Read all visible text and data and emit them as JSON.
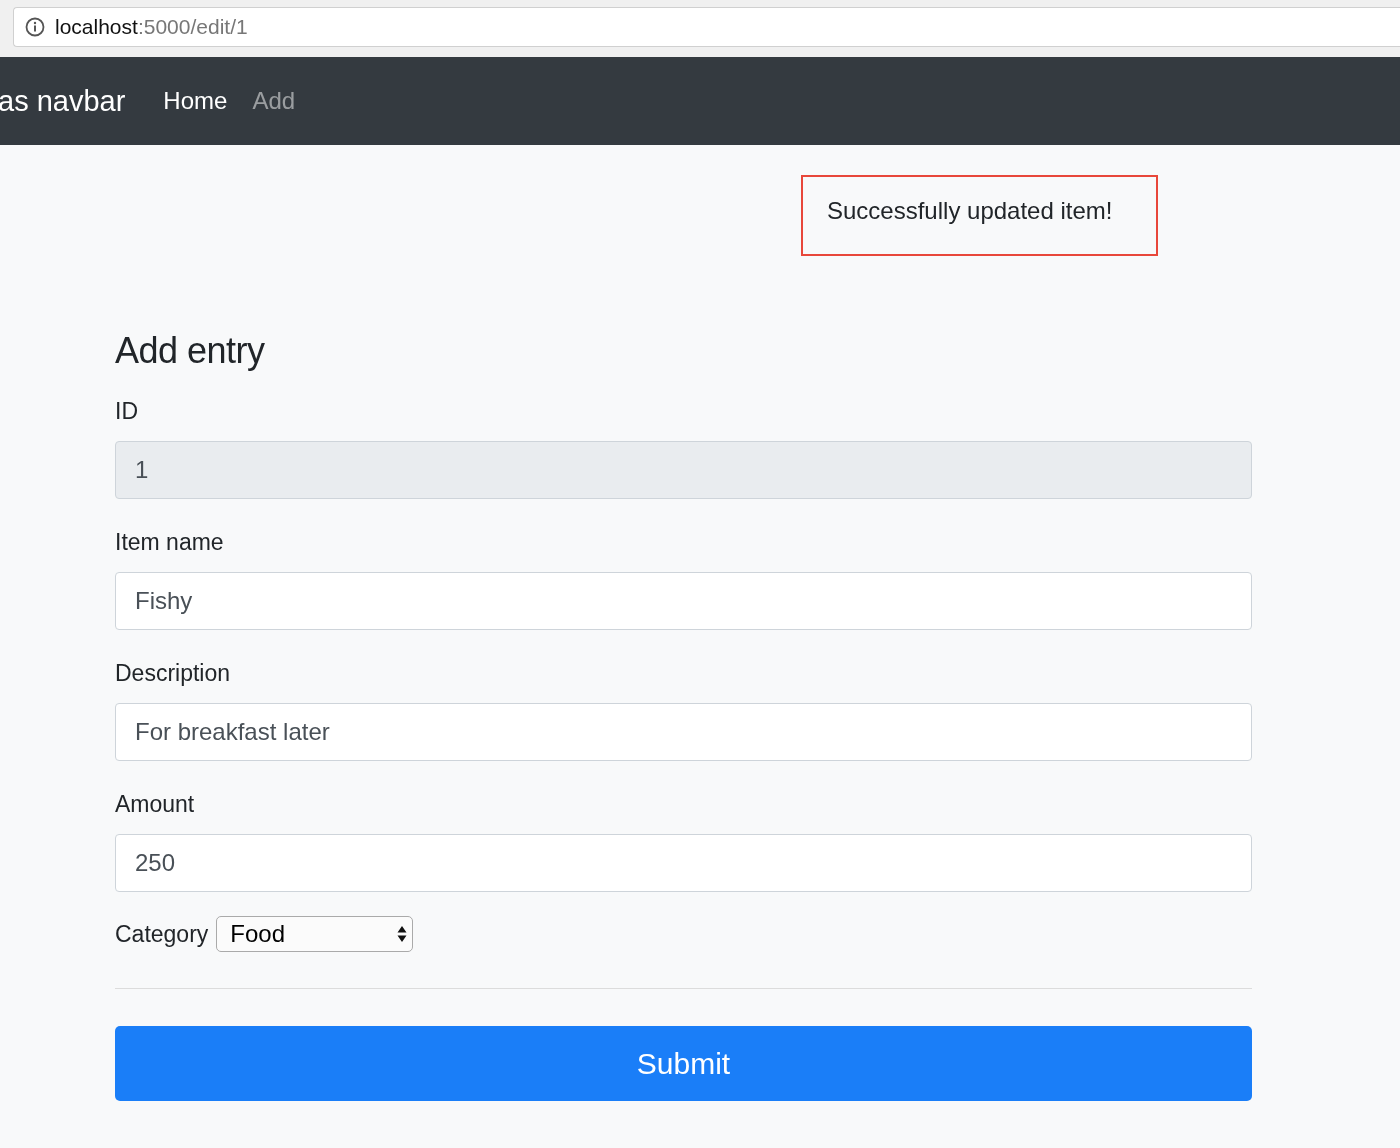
{
  "browser": {
    "address_host": "localhost",
    "address_path": ":5000/edit/1"
  },
  "navbar": {
    "brand": "as navbar",
    "links": [
      {
        "label": "Home",
        "selected": true
      },
      {
        "label": "Add",
        "selected": false
      }
    ]
  },
  "alert": {
    "message": "Successfully updated item!"
  },
  "form": {
    "title": "Add entry",
    "fields": [
      {
        "label": "ID",
        "value": "1",
        "disabled": true
      },
      {
        "label": "Item name",
        "value": "Fishy",
        "disabled": false
      },
      {
        "label": "Description",
        "value": "For breakfast later",
        "disabled": false
      },
      {
        "label": "Amount",
        "value": "250",
        "disabled": false
      }
    ],
    "category": {
      "label": "Category",
      "value": "Food"
    },
    "submit": "Submit"
  }
}
